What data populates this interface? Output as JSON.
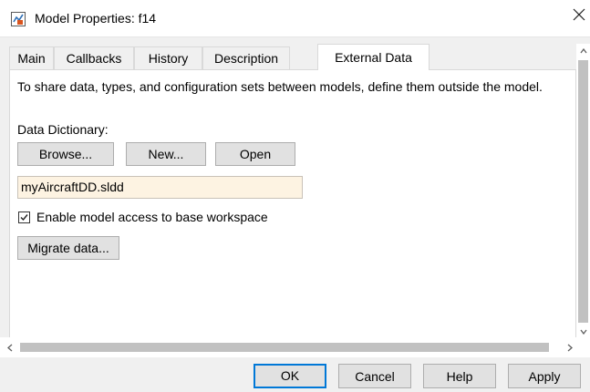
{
  "window": {
    "title": "Model Properties: f14",
    "icon": "simulink-model-icon",
    "close_icon": "close-icon"
  },
  "tabs": [
    {
      "label": "Main",
      "active": false
    },
    {
      "label": "Callbacks",
      "active": false
    },
    {
      "label": "History",
      "active": false
    },
    {
      "label": "Description",
      "active": false
    },
    {
      "label": "External Data",
      "active": true
    }
  ],
  "external_data": {
    "info_text": "To share data, types, and configuration sets between models, define them outside the model.",
    "data_dictionary_label": "Data Dictionary:",
    "browse_label": "Browse...",
    "new_label": "New...",
    "open_label": "Open",
    "dictionary_value": "myAircraftDD.sldd",
    "base_workspace_checkbox": {
      "label": "Enable model access to base workspace",
      "checked": true
    },
    "migrate_label": "Migrate data..."
  },
  "scrollbars": {
    "vertical_up_icon": "chevron-up-icon",
    "vertical_down_icon": "chevron-down-icon",
    "horizontal_left_icon": "chevron-left-icon",
    "horizontal_right_icon": "chevron-right-icon"
  },
  "footer": {
    "ok_label": "OK",
    "cancel_label": "Cancel",
    "help_label": "Help",
    "apply_label": "Apply"
  },
  "colors": {
    "accent": "#0078d7",
    "field_background": "#fdf3e2",
    "icon_orange": "#d9541e",
    "icon_blue": "#2f6fb5"
  }
}
